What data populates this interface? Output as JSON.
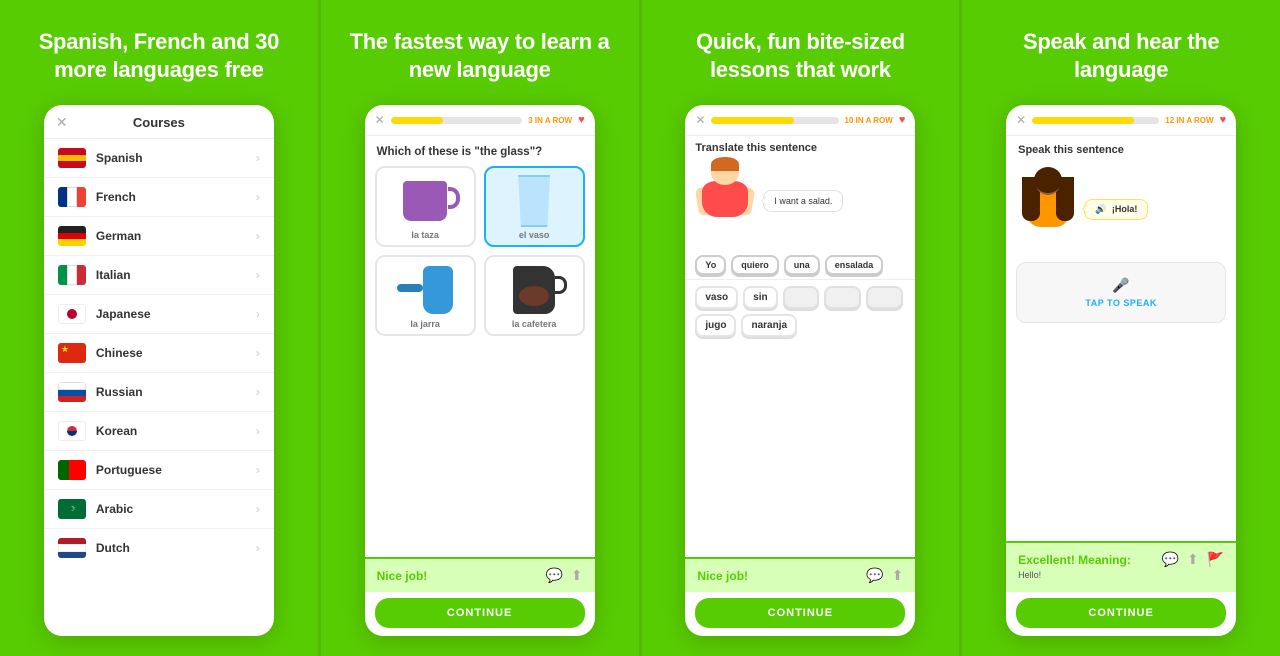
{
  "panels": [
    {
      "id": "panel1",
      "title": "Spanish, French and 30 more languages free",
      "phone": {
        "header": "Courses",
        "courses": [
          {
            "name": "Spanish",
            "flag": "es"
          },
          {
            "name": "French",
            "flag": "fr"
          },
          {
            "name": "German",
            "flag": "de"
          },
          {
            "name": "Italian",
            "flag": "it"
          },
          {
            "name": "Japanese",
            "flag": "jp"
          },
          {
            "name": "Chinese",
            "flag": "cn"
          },
          {
            "name": "Russian",
            "flag": "ru"
          },
          {
            "name": "Korean",
            "flag": "kr"
          },
          {
            "name": "Portuguese",
            "flag": "pt"
          },
          {
            "name": "Arabic",
            "flag": "ar"
          },
          {
            "name": "Dutch",
            "flag": "nl"
          }
        ]
      }
    },
    {
      "id": "panel2",
      "title": "The fastest way to learn a new language",
      "phone": {
        "progress_label": "3 IN A ROW",
        "progress_percent": 40,
        "question": "Which of these is \"the glass\"?",
        "options": [
          {
            "label": "la taza",
            "type": "mug",
            "selected": false
          },
          {
            "label": "el vaso",
            "type": "glass",
            "selected": true
          },
          {
            "label": "la jarra",
            "type": "pitcher",
            "selected": false
          },
          {
            "label": "la cafetera",
            "type": "coffeepot",
            "selected": false
          }
        ],
        "nice_job": "Nice job!",
        "continue_label": "CONTINUE"
      }
    },
    {
      "id": "panel3",
      "title": "Quick, fun bite-sized lessons that work",
      "phone": {
        "progress_label": "10 IN A ROW",
        "progress_percent": 65,
        "question": "Translate this sentence",
        "speech_text": "I want a salad.",
        "word_chips_used": [
          "Yo",
          "quiero",
          "una",
          "ensalada"
        ],
        "word_bank": [
          "vaso",
          "sin",
          "",
          "",
          "",
          "jugo",
          "naranja"
        ],
        "nice_job": "Nice job!",
        "continue_label": "CONTINUE"
      }
    },
    {
      "id": "panel4",
      "title": "Speak and hear the language",
      "phone": {
        "progress_label": "12 IN A ROW",
        "progress_percent": 80,
        "question": "Speak this sentence",
        "hola_text": "¡Hola!",
        "tap_to_speak": "TAP TO SPEAK",
        "excellent_title": "Excellent! Meaning:",
        "excellent_sub": "Hello!",
        "feedback_icons": [
          "💬",
          "⬆",
          "🚩"
        ],
        "continue_label": "CONTINUE"
      }
    }
  ],
  "colors": {
    "green": "#58cc02",
    "green_dark": "#4caf00",
    "yellow": "#ffd900",
    "blue": "#1cb0f6",
    "red": "#ff4b4b"
  }
}
